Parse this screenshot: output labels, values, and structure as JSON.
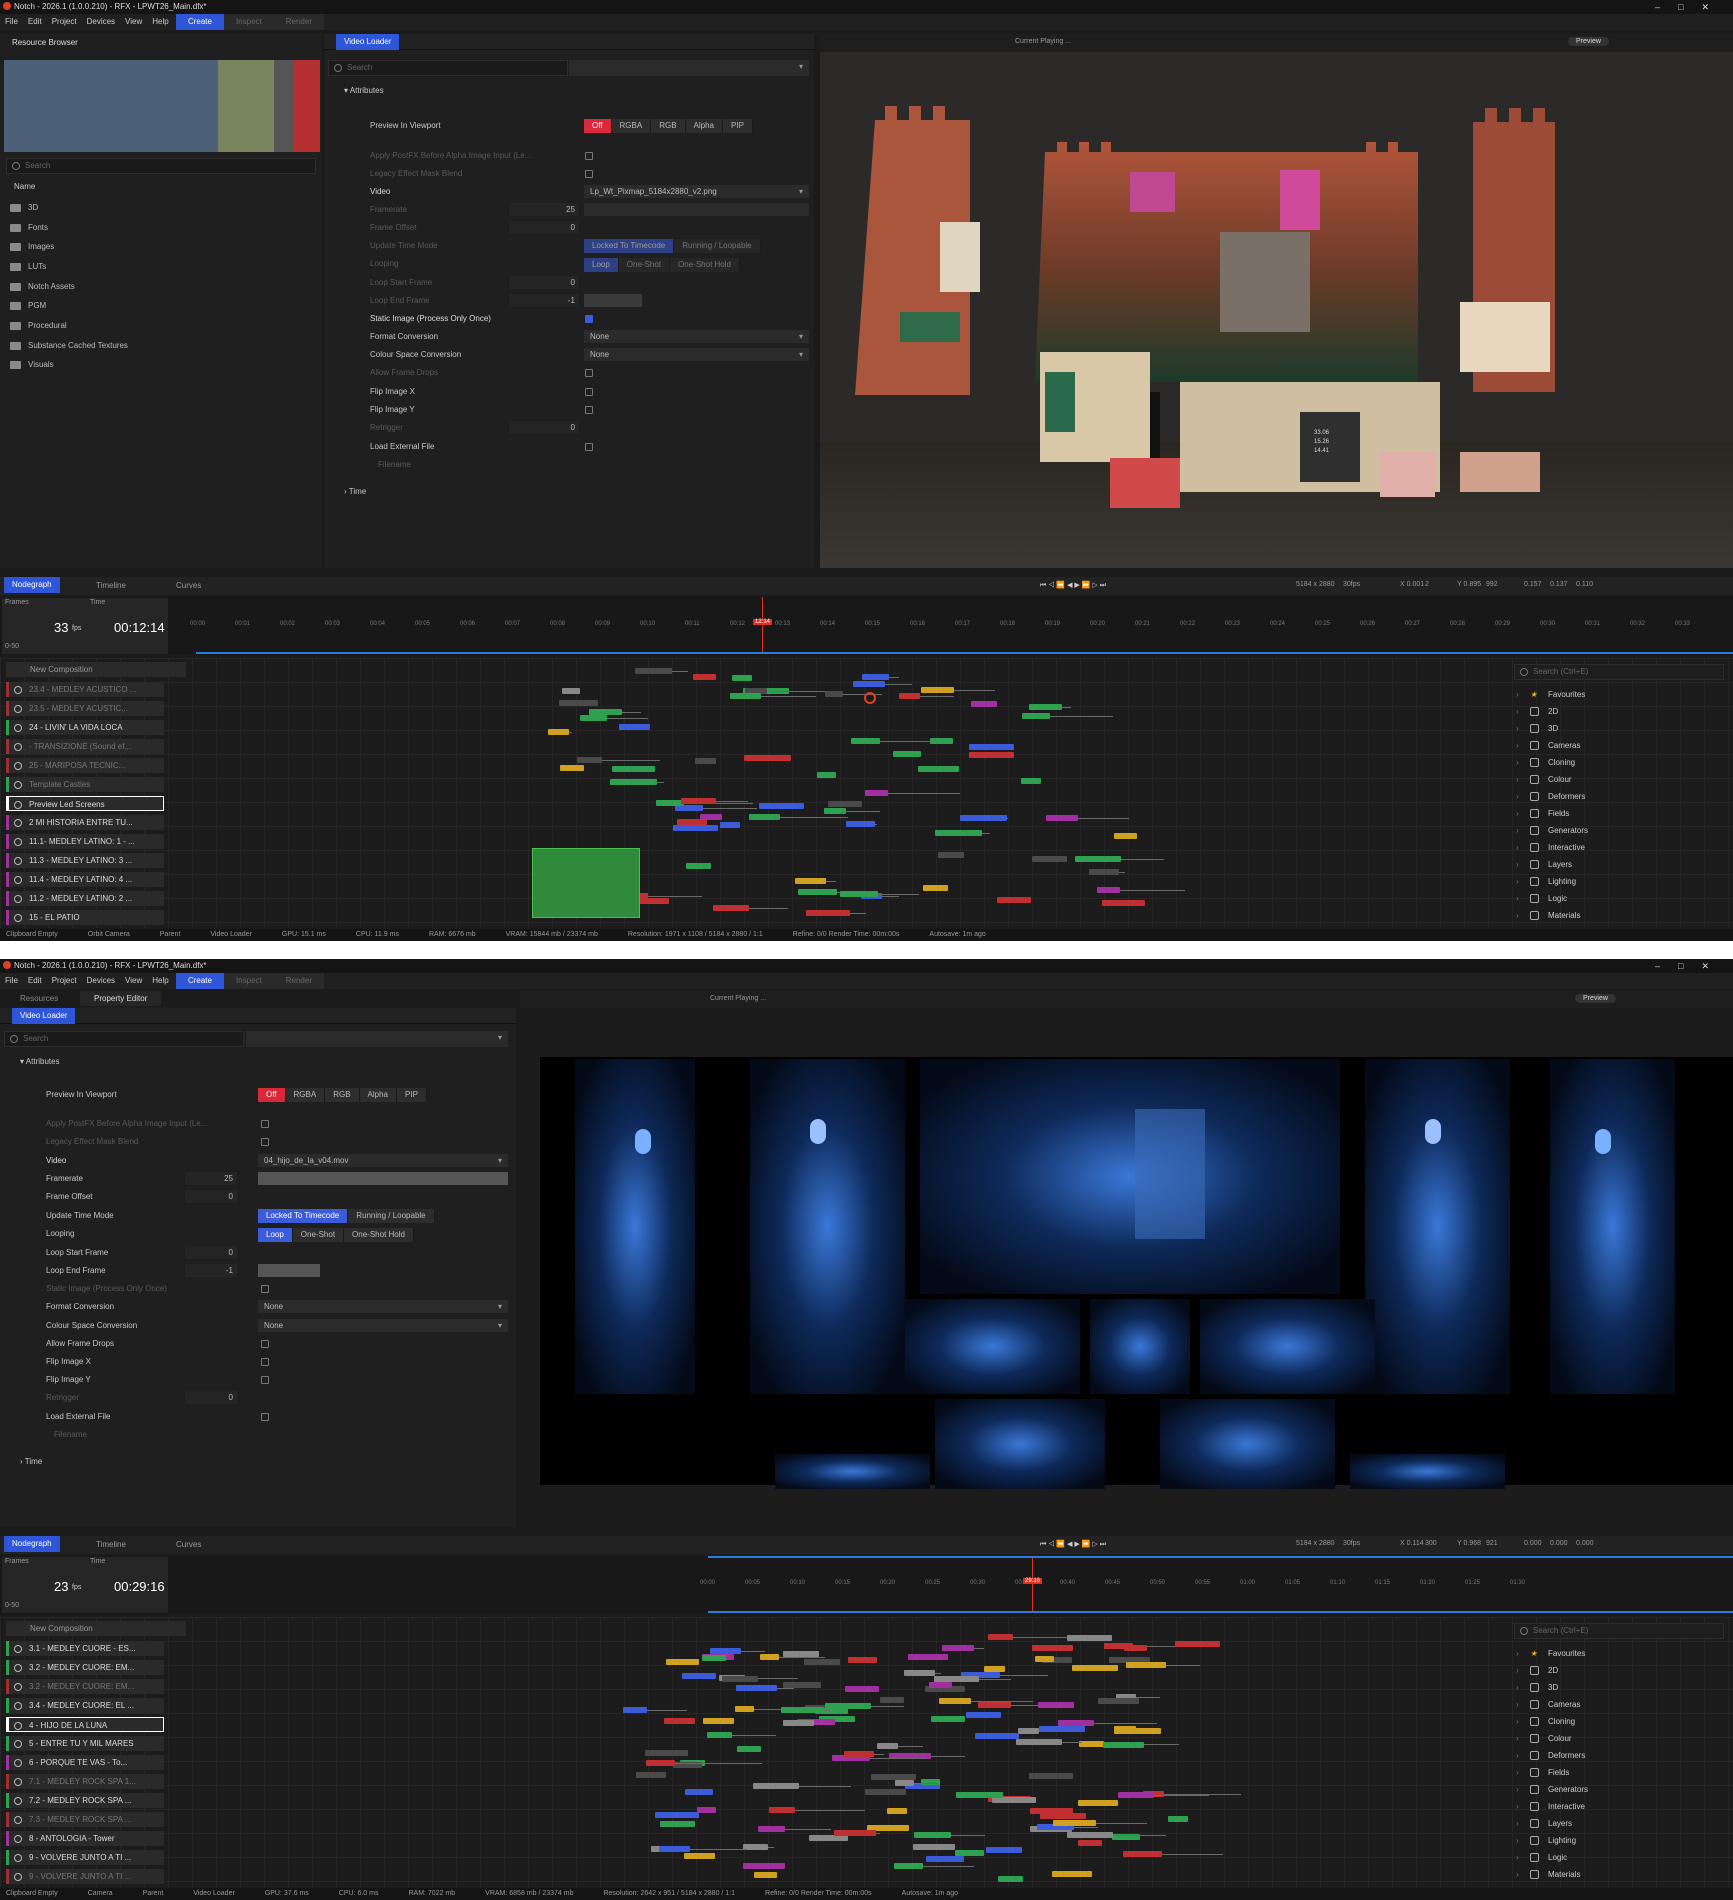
{
  "w1": {
    "title": "Notch - 2026.1 (1.0.0.210) - RFX - LPWT26_Main.dfx*",
    "menu": [
      "File",
      "Edit",
      "Project",
      "Devices",
      "View",
      "Help"
    ],
    "modes": [
      "Create",
      "Inspect",
      "Render"
    ],
    "resource_browser": {
      "title": "Resource Browser",
      "search_placeholder": "Search",
      "name_header": "Name",
      "folders": [
        "3D",
        "Fonts",
        "Images",
        "LUTs",
        "Notch Assets",
        "PGM",
        "Procedural",
        "Substance Cached Textures",
        "Visuals"
      ]
    },
    "prop": {
      "tab": "Video Loader",
      "search_placeholder": "Search",
      "section": "Attributes",
      "preview_label": "Preview In Viewport",
      "preview_opts": [
        "Off",
        "RGBA",
        "RGB",
        "Alpha",
        "PIP"
      ],
      "rows": {
        "apply_postfx": "Apply PostFX Before Alpha Image Input (Le...",
        "legacy": "Legacy Effect Mask Blend",
        "video": "Video",
        "video_file": "Lp_Wt_Pixmap_5184x2880_v2.png",
        "framerate": "Framerate",
        "framerate_val": "25",
        "frame_offset": "Frame Offset",
        "frame_offset_val": "0",
        "update_mode": "Update Time Mode",
        "update_opts": [
          "Locked To Timecode",
          "Running / Loopable"
        ],
        "looping": "Looping",
        "loop_opts": [
          "Loop",
          "One-Shot",
          "One-Shot Hold"
        ],
        "loop_start": "Loop Start Frame",
        "loop_start_val": "0",
        "loop_end": "Loop End Frame",
        "loop_end_val": "-1",
        "static": "Static Image (Process Only Once)",
        "format_conv": "Format Conversion",
        "format_val": "None",
        "colour_conv": "Colour Space Conversion",
        "colour_val": "None",
        "allow_drops": "Allow Frame Drops",
        "flip_x": "Flip Image X",
        "flip_y": "Flip Image Y",
        "retrigger": "Retrigger",
        "retrigger_val": "0",
        "load_ext": "Load External File",
        "filename": "Filename"
      },
      "time_section": "Time"
    },
    "viewport": {
      "camera": "Current Playing ...",
      "preview": "Preview",
      "overlay": [
        "33.06",
        "15.26",
        "14.41"
      ]
    },
    "bottom": {
      "tabs": [
        "Nodegraph",
        "Timeline",
        "Curves"
      ],
      "res": "5184 x 2880",
      "fps_label": "30fps",
      "coords": [
        "X 0.001",
        "2",
        "Y 0.895",
        "992",
        "0.157",
        "0.137",
        "0.110"
      ],
      "frames_label": "Frames",
      "time_label": "Time",
      "fps": "33",
      "fps_unit": "fps",
      "timecode": "00:12:14",
      "range": "0-50",
      "playhead": "12:14",
      "ticks": [
        "00:00",
        "00:01",
        "00:02",
        "00:03",
        "00:04",
        "00:05",
        "00:06",
        "00:07",
        "00:08",
        "00:09",
        "00:10",
        "00:11",
        "00:12",
        "00:13",
        "00:14",
        "00:15",
        "00:16",
        "00:17",
        "00:18",
        "00:19",
        "00:20",
        "00:21",
        "00:22",
        "00:23",
        "00:24",
        "00:25",
        "00:26",
        "00:27",
        "00:28",
        "00:29",
        "00:30",
        "00:31",
        "00:32",
        "00:33"
      ],
      "new_comp": "New Composition",
      "layers": [
        {
          "name": "23.4 - MEDLEY ACUSTICO ...",
          "c": "#a03030",
          "dim": true
        },
        {
          "name": "23.5 - MEDLEY ACUSTIC...",
          "c": "#a03030",
          "dim": true
        },
        {
          "name": "24 - LIVIN' LA VIDA LOCA",
          "c": "#2fa050",
          "dim": false
        },
        {
          "name": "- TRANSIZIONE (Sound ef...",
          "c": "#a03030",
          "dim": true
        },
        {
          "name": "25 - MARIPOSA TECNIC...",
          "c": "#a03030",
          "dim": true
        },
        {
          "name": "Template Castles",
          "c": "#2fa050",
          "dim": true
        },
        {
          "name": "Preview Led Screens",
          "c": "#3b6bd9",
          "dim": false,
          "sel": true
        },
        {
          "name": "2 MI HISTORIA ENTRE TU...",
          "c": "#a030a0",
          "dim": false
        },
        {
          "name": "11.1- MEDLEY LATINO: 1 - ...",
          "c": "#a030a0",
          "dim": false
        },
        {
          "name": "11.3 - MEDLEY LATINO: 3 ...",
          "c": "#a030a0",
          "dim": false
        },
        {
          "name": "11.4 - MEDLEY LATINO: 4 ...",
          "c": "#a030a0",
          "dim": false
        },
        {
          "name": "11.2 - MEDLEY LATINO: 2 ...",
          "c": "#a030a0",
          "dim": false
        },
        {
          "name": "15 - EL PATIO",
          "c": "#a030a0",
          "dim": false
        }
      ],
      "search_placeholder": "Search (Ctrl+E)",
      "categories": [
        "Favourites",
        "2D",
        "3D",
        "Cameras",
        "Cloning",
        "Colour",
        "Deformers",
        "Fields",
        "Generators",
        "Interactive",
        "Layers",
        "Lighting",
        "Logic",
        "Materials"
      ],
      "status": [
        "Clipboard Empty",
        "Orbit Camera",
        "Parent",
        "Video Loader",
        "GPU: 15.1 ms",
        "CPU: 11.9 ms",
        "RAM: 6676 mb",
        "VRAM: 15844 mb / 23374 mb",
        "Resolution: 1971 x 1108 / 5184 x 2880 / 1:1",
        "Refine: 0/0 Render Time: 00m:00s",
        "Autosave: 1m ago"
      ]
    }
  },
  "w2": {
    "title": "Notch - 2026.1 (1.0.0.210) - RFX - LPWT26_Main.dfx*",
    "menu": [
      "File",
      "Edit",
      "Project",
      "Devices",
      "View",
      "Help"
    ],
    "modes": [
      "Create",
      "Inspect",
      "Render"
    ],
    "panel_tabs": [
      "Resources",
      "Property Editor"
    ],
    "prop": {
      "tab": "Video Loader",
      "search_placeholder": "Search",
      "section": "Attributes",
      "preview_label": "Preview In Viewport",
      "preview_opts": [
        "Off",
        "RGBA",
        "RGB",
        "Alpha",
        "PIP"
      ],
      "rows": {
        "apply_postfx": "Apply PostFX Before Alpha Image Input (Le...",
        "legacy": "Legacy Effect Mask Blend",
        "video": "Video",
        "video_file": "04_hijo_de_la_v04.mov",
        "framerate": "Framerate",
        "framerate_val": "25",
        "frame_offset": "Frame Offset",
        "frame_offset_val": "0",
        "update_mode": "Update Time Mode",
        "update_opts": [
          "Locked To Timecode",
          "Running / Loopable"
        ],
        "looping": "Looping",
        "loop_opts": [
          "Loop",
          "One-Shot",
          "One-Shot Hold"
        ],
        "loop_start": "Loop Start Frame",
        "loop_start_val": "0",
        "loop_end": "Loop End Frame",
        "loop_end_val": "-1",
        "static": "Static Image (Process Only Once)",
        "format_conv": "Format Conversion",
        "format_val": "None",
        "colour_conv": "Colour Space Conversion",
        "colour_val": "None",
        "allow_drops": "Allow Frame Drops",
        "flip_x": "Flip Image X",
        "flip_y": "Flip Image Y",
        "retrigger": "Retrigger",
        "retrigger_val": "0",
        "load_ext": "Load External File",
        "filename": "Filename"
      },
      "time_section": "Time"
    },
    "viewport": {
      "camera": "Current Playing ...",
      "preview": "Preview"
    },
    "bottom": {
      "tabs": [
        "Nodegraph",
        "Timeline",
        "Curves"
      ],
      "res": "5184 x 2880",
      "fps_label": "30fps",
      "coords": [
        "X 0.114",
        "300",
        "Y 0.968",
        "921",
        "0.000",
        "0.000",
        "0.000"
      ],
      "frames_label": "Frames",
      "time_label": "Time",
      "fps": "23",
      "fps_unit": "fps",
      "timecode": "00:29:16",
      "range": "0-50",
      "playhead": "29:16",
      "ticks": [
        "00:00",
        "00:05",
        "00:10",
        "00:15",
        "00:20",
        "00:25",
        "00:30",
        "00:35",
        "00:40",
        "00:45",
        "00:50",
        "00:55",
        "01:00",
        "01:05",
        "01:10",
        "01:15",
        "01:20",
        "01:25",
        "01:30"
      ],
      "new_comp": "New Composition",
      "layers": [
        {
          "name": "3.1 - MEDLEY CUORE - ES...",
          "c": "#2fa050",
          "dim": false
        },
        {
          "name": "3.2 - MEDLEY CUORE: EM...",
          "c": "#2fa050",
          "dim": false
        },
        {
          "name": "3.2 - MEDLEY CUORE: EM...",
          "c": "#a03030",
          "dim": true
        },
        {
          "name": "3.4 - MEDLEY CUORE: EL ...",
          "c": "#2fa050",
          "dim": false
        },
        {
          "name": "4 - HIJO DE LA LUNA",
          "c": "#3b6bd9",
          "dim": false,
          "sel": true
        },
        {
          "name": "5 - ENTRE TU Y MIL MARES",
          "c": "#2fa050",
          "dim": false
        },
        {
          "name": "6 - PORQUE TE VAS - To...",
          "c": "#a030a0",
          "dim": false
        },
        {
          "name": "7.1 - MEDLEY ROCK SPA 1...",
          "c": "#a03030",
          "dim": true
        },
        {
          "name": "7.2 - MEDLEY ROCK SPA ...",
          "c": "#2fa050",
          "dim": false
        },
        {
          "name": "7.3 - MEDLEY ROCK SPA ...",
          "c": "#a03030",
          "dim": true
        },
        {
          "name": "8 - ANTOLOGIA - Tower",
          "c": "#a030a0",
          "dim": false
        },
        {
          "name": "9 - VOLVERE JUNTO A TI ...",
          "c": "#2fa050",
          "dim": false
        },
        {
          "name": "9 - VOLVERE JUNTO A TI ...",
          "c": "#a03030",
          "dim": true
        }
      ],
      "search_placeholder": "Search (Ctrl+E)",
      "categories": [
        "Favourites",
        "2D",
        "3D",
        "Cameras",
        "Cloning",
        "Colour",
        "Deformers",
        "Fields",
        "Generators",
        "Interactive",
        "Layers",
        "Lighting",
        "Logic",
        "Materials"
      ],
      "status": [
        "Clipboard Empty",
        "Camera",
        "Parent",
        "Video Loader",
        "GPU: 37.6 ms",
        "CPU: 6.0 ms",
        "RAM: 7022 mb",
        "VRAM: 6858 mb / 23374 mb",
        "Resolution: 2642 x 951 / 5184 x 2880 / 1:1",
        "Refine: 0/0 Render Time: 00m:00s",
        "Autosave: 1m ago"
      ]
    }
  },
  "colors": {
    "accent": "#2f56d8",
    "off_red": "#d8283a",
    "playhead": "#e03020"
  }
}
